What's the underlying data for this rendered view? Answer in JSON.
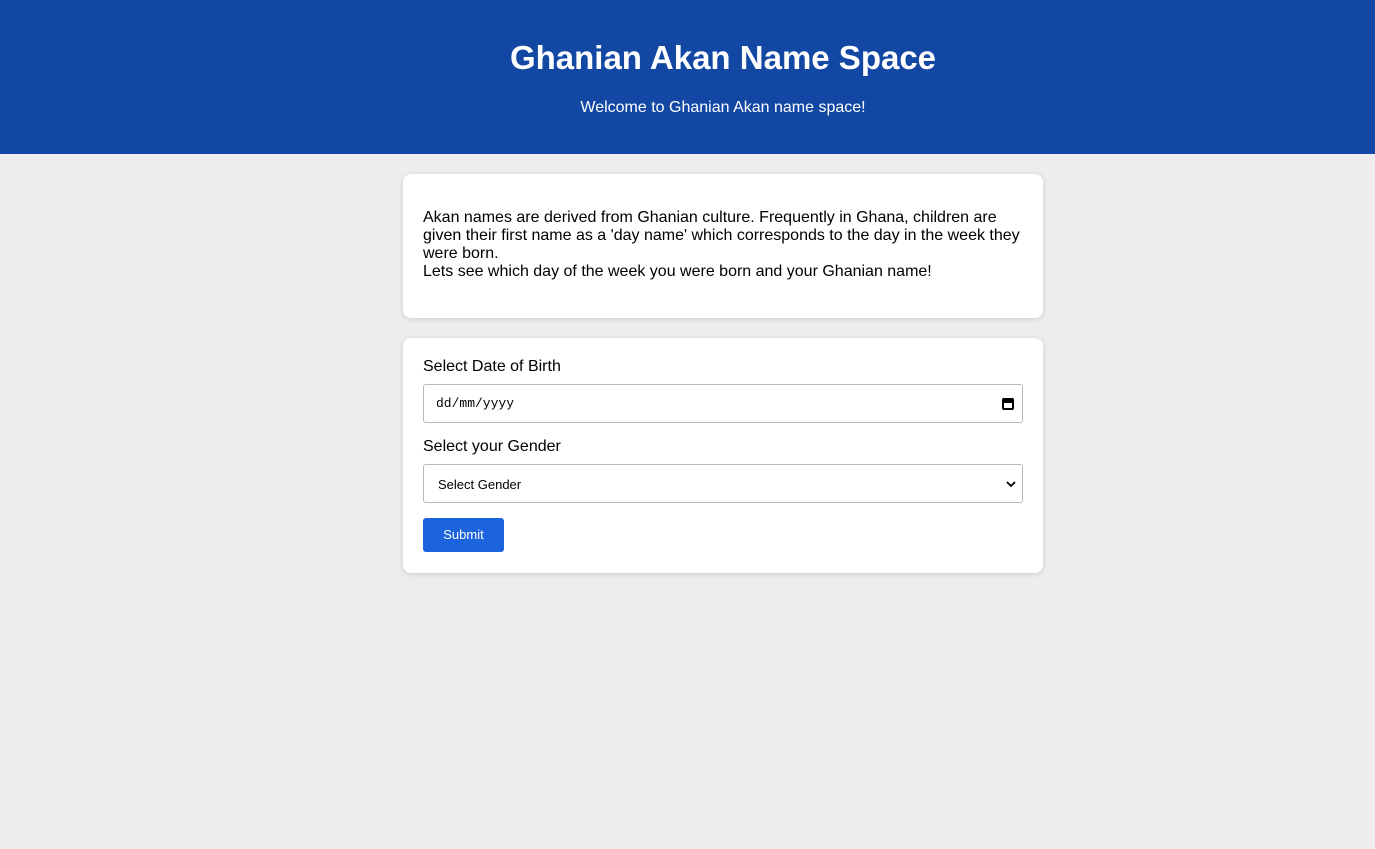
{
  "header": {
    "title": "Ghanian Akan Name Space",
    "subtitle": "Welcome to Ghanian Akan name space!",
    "background": "#1248a4"
  },
  "intro": {
    "line1": "Akan names are derived from Ghanian culture. Frequently in Ghana, children are given their first name as a 'day name' which corresponds to the day in the week they were born.",
    "line2": "Lets see which day of the week you were born and your Ghanian name!"
  },
  "form": {
    "dob_label": "Select Date of Birth",
    "dob_placeholder": "dd/mm/yyyy",
    "gender_label": "Select your Gender",
    "gender_selected": "Select Gender",
    "submit_label": "Submit",
    "submit_color": "#1c63de"
  },
  "icons": {
    "date": "calendar-icon",
    "select": "chevron-down-icon"
  }
}
